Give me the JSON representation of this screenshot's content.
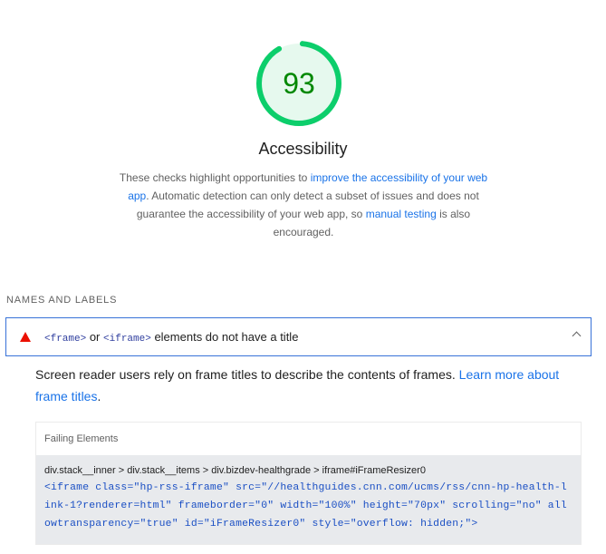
{
  "score": {
    "value": "93",
    "fraction": 0.93,
    "ring_color": "#0cce6b",
    "fill_color": "#e6f9ee",
    "text_color": "#008800"
  },
  "category": {
    "title": "Accessibility",
    "description": {
      "part1": "These checks highlight opportunities to ",
      "link1": "improve the accessibility of your web app",
      "part2": ". Automatic detection can only detect a subset of issues and does not guarantee the accessibility of your web app, so ",
      "link2": "manual testing",
      "part3": " is also encouraged."
    }
  },
  "group": {
    "title": "NAMES AND LABELS"
  },
  "audit": {
    "icon": "fail-triangle-icon",
    "title_code1": "<frame>",
    "title_mid": " or ",
    "title_code2": "<iframe>",
    "title_rest": " elements do not have a title",
    "expanded": true,
    "description": "Screen reader users rely on frame titles to describe the contents of frames. ",
    "learn_more": "Learn more about frame titles",
    "description_end": ".",
    "table_header": "Failing Elements",
    "items": [
      {
        "path": "div.stack__inner > div.stack__items > div.bizdev-healthgrade > iframe#iFrameResizer0",
        "snippet": "<iframe class=\"hp-rss-iframe\" src=\"//healthguides.cnn.com/ucms/rss/cnn-hp-health-link-1?renderer=html\" frameborder=\"0\" width=\"100%\" height=\"70px\" scrolling=\"no\" allowtransparency=\"true\" id=\"iFrameResizer0\" style=\"overflow: hidden;\">"
      }
    ]
  }
}
